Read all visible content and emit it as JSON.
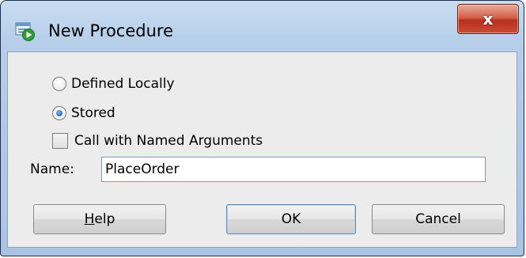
{
  "window": {
    "title": "New Procedure",
    "close_glyph": "x",
    "icon": "procedure-run-icon"
  },
  "form": {
    "options": [
      {
        "label": "Defined Locally",
        "selected": false
      },
      {
        "label": "Stored",
        "selected": true
      }
    ],
    "named_args": {
      "label": "Call with Named Arguments",
      "checked": false
    },
    "name_label": "Name:",
    "name_value": "PlaceOrder"
  },
  "buttons": {
    "help_mnemonic": "H",
    "help_rest": "elp",
    "ok": "OK",
    "cancel": "Cancel"
  },
  "colors": {
    "accent": "#2d6fc4",
    "close": "#c74530"
  }
}
